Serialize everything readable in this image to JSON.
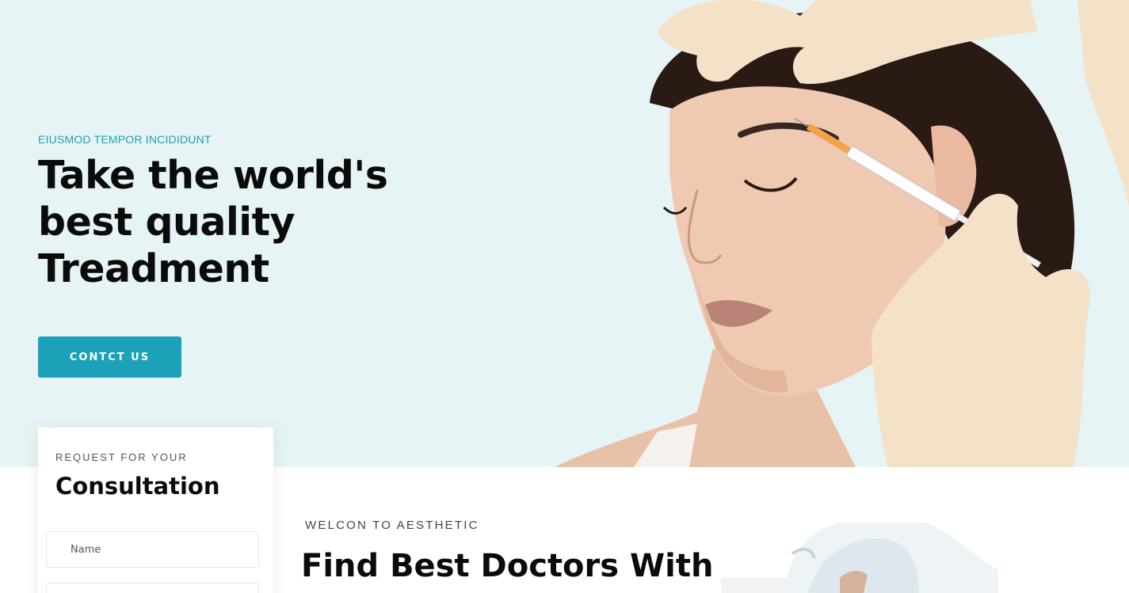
{
  "hero": {
    "eyebrow": "EIUSMOD TEMPOR INCIDIDUNT",
    "headline_line1": "Take the world's",
    "headline_line2": "best quality",
    "headline_line3": "Treadment",
    "cta_label": "CONTCT US",
    "bg_color": "#e6f4f6",
    "accent": "#1ba2b9"
  },
  "consultation": {
    "kicker": "REQUEST FOR YOUR",
    "title": "Consultation",
    "name_placeholder": "Name"
  },
  "welcome": {
    "kicker": "WELCON TO AESTHETIC",
    "title": "Find Best Doctors With"
  }
}
